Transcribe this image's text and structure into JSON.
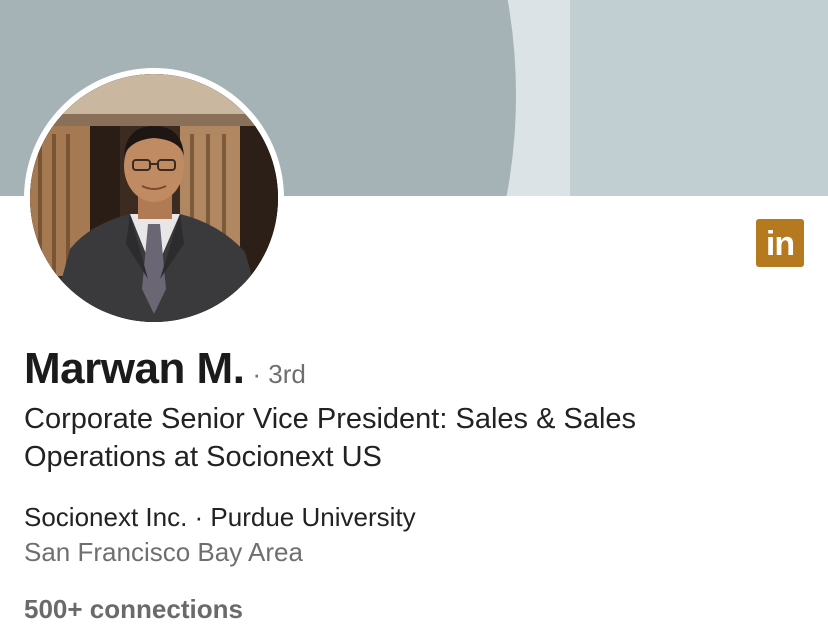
{
  "profile": {
    "name": "Marwan M.",
    "degree": "· 3rd",
    "headline": "Corporate Senior Vice President: Sales & Sales Operations at Socionext US",
    "company_education": "Socionext Inc. · Purdue University",
    "location": "San Francisco Bay Area",
    "connections": "500+ connections"
  },
  "badge": {
    "label": "in",
    "icon": "linkedin-icon",
    "color": "#b5791f"
  },
  "colors": {
    "cover_dark": "#a5b3b7",
    "cover_light": "#dbe3e6",
    "cover_right": "#c1cfd3"
  }
}
